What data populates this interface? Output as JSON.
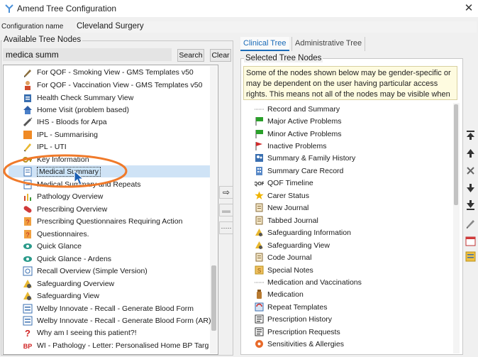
{
  "window": {
    "title": "Amend Tree Configuration",
    "close_glyph": "✕"
  },
  "config": {
    "label": "Configuration name",
    "value": "Cleveland Surgery"
  },
  "available": {
    "legend": "Available Tree Nodes",
    "search_value": "medica summ",
    "search_button": "Search",
    "clear_button": "Clear",
    "items": [
      {
        "label": "For QOF - Smoking View - GMS Templates v50",
        "icon": "pen-icon"
      },
      {
        "label": "For QOF - Vaccination View - GMS Templates v50",
        "icon": "person-icon"
      },
      {
        "label": "Health Check Summary View",
        "icon": "clipboard-icon"
      },
      {
        "label": "Home Visit (problem based)",
        "icon": "house-icon"
      },
      {
        "label": "IHS - Bloods for Arpa",
        "icon": "syringe-icon"
      },
      {
        "label": "IPL - Summarising",
        "icon": "orange-square-icon"
      },
      {
        "label": "IPL - UTI",
        "icon": "pencil-icon"
      },
      {
        "label": "Key Information",
        "icon": "key-icon"
      },
      {
        "label": "Medical Summary",
        "icon": "document-icon"
      },
      {
        "label": "Medical Summary and Repeats",
        "icon": "document-icon"
      },
      {
        "label": "Pathology Overview",
        "icon": "chart-icon"
      },
      {
        "label": "Prescribing Overview",
        "icon": "pill-icon"
      },
      {
        "label": "Prescribing Questionnaires Requiring Action",
        "icon": "question-doc-icon"
      },
      {
        "label": "Questionnaires.",
        "icon": "question-doc-icon"
      },
      {
        "label": "Quick Glance",
        "icon": "eye-icon"
      },
      {
        "label": "Quick Glance - Ardens",
        "icon": "eye-icon"
      },
      {
        "label": "Recall Overview (Simple Version)",
        "icon": "recall-icon"
      },
      {
        "label": "Safeguarding Overview",
        "icon": "safeguard-icon"
      },
      {
        "label": "Safeguarding View",
        "icon": "safeguard-icon"
      },
      {
        "label": "Welby Innovate - Recall - Generate Blood Form",
        "icon": "form-icon"
      },
      {
        "label": "Welby Innovate - Recall - Generate Blood Form (AR)",
        "icon": "form-icon"
      },
      {
        "label": "Why am I seeing this patient?!",
        "icon": "question-icon"
      },
      {
        "label": "WI - Pathology - Letter: Personalised Home BP Targ",
        "icon": "bp-icon"
      }
    ]
  },
  "mid_buttons": {
    "add": "⇨",
    "folder": "▬",
    "separator": "·····"
  },
  "tabs": [
    {
      "label": "Clinical Tree"
    },
    {
      "label": "Administrative Tree"
    }
  ],
  "selected": {
    "legend": "Selected Tree Nodes",
    "info": "Some of the nodes shown below may be gender-specific or may be dependent on the user having particular access rights. This means not all of the nodes may be visible when",
    "items": [
      {
        "label": "Record and Summary",
        "icon": "dots-icon"
      },
      {
        "label": "Major Active Problems",
        "icon": "green-flag-icon"
      },
      {
        "label": "Minor Active Problems",
        "icon": "green-flag-icon"
      },
      {
        "label": "Inactive Problems",
        "icon": "red-flag-icon"
      },
      {
        "label": "Summary & Family History",
        "icon": "family-icon"
      },
      {
        "label": "Summary Care Record",
        "icon": "building-icon"
      },
      {
        "label": "QOF Timeline",
        "icon": "qof-icon"
      },
      {
        "label": "Carer Status",
        "icon": "star-icon"
      },
      {
        "label": "New Journal",
        "icon": "journal-icon"
      },
      {
        "label": "Tabbed Journal",
        "icon": "journal-icon"
      },
      {
        "label": "Safeguarding Information",
        "icon": "safeguard-icon"
      },
      {
        "label": "Safeguarding View",
        "icon": "safeguard-icon"
      },
      {
        "label": "Code Journal",
        "icon": "journal-icon"
      },
      {
        "label": "Special Notes",
        "icon": "notes-icon"
      },
      {
        "label": "Medication and Vaccinations",
        "icon": "dots-icon"
      },
      {
        "label": "Medication",
        "icon": "bottle-icon"
      },
      {
        "label": "Repeat Templates",
        "icon": "repeat-icon"
      },
      {
        "label": "Prescription History",
        "icon": "rx-icon"
      },
      {
        "label": "Prescription Requests",
        "icon": "rx-icon"
      },
      {
        "label": "Sensitivities & Allergies",
        "icon": "allergy-icon"
      }
    ]
  },
  "side_buttons": [
    "move-top-icon",
    "move-up-icon",
    "delete-icon",
    "move-down-icon",
    "move-bottom-icon",
    "edit-icon",
    "calendar-icon",
    "properties-icon"
  ],
  "colors": {
    "accent": "#1a6bb8",
    "annotation": "#f07a2a",
    "selection": "#cce4f7",
    "info_bg": "#fefbe0"
  }
}
